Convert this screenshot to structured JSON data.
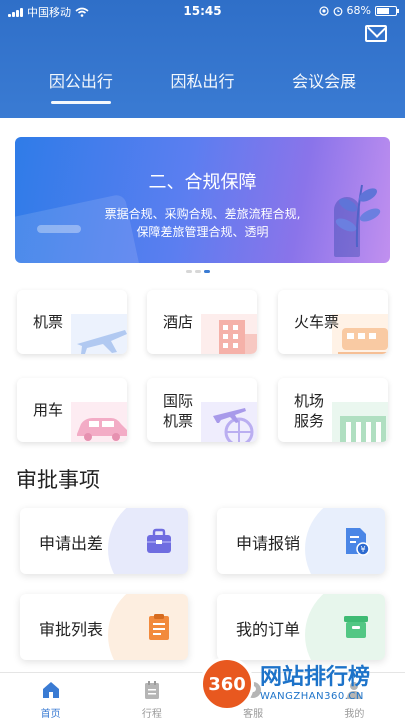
{
  "status_bar": {
    "carrier": "中国移动",
    "time": "15:45",
    "battery": "68%",
    "battery_level": 0.68
  },
  "header": {
    "tabs": [
      {
        "label": "因公出行",
        "active": true
      },
      {
        "label": "因私出行",
        "active": false
      },
      {
        "label": "会议会展",
        "active": false
      }
    ],
    "mail_icon": "mail-icon"
  },
  "banner": {
    "title": "二、合规保障",
    "line1": "票据合规、采购合规、差旅流程合规,",
    "line2": "保障差旅管理合规、透明",
    "page_count": 3,
    "current_page": 3
  },
  "services": [
    {
      "label": "机票",
      "icon": "airplane-icon"
    },
    {
      "label": "酒店",
      "icon": "hotel-icon"
    },
    {
      "label": "火车票",
      "icon": "train-icon"
    },
    {
      "label": "用车",
      "icon": "car-icon"
    },
    {
      "label": "国际\n机票",
      "line1": "国际",
      "line2": "机票",
      "icon": "globe-plane-icon"
    },
    {
      "label": "机场\n服务",
      "line1": "机场",
      "line2": "服务",
      "icon": "airport-icon"
    }
  ],
  "approval": {
    "title": "审批事项",
    "items": [
      {
        "label": "申请出差",
        "icon": "briefcase-icon"
      },
      {
        "label": "申请报销",
        "icon": "receipt-icon"
      },
      {
        "label": "审批列表",
        "icon": "clipboard-icon"
      },
      {
        "label": "我的订单",
        "icon": "inbox-icon"
      }
    ]
  },
  "bottom_nav": [
    {
      "label": "首页",
      "icon": "home-icon",
      "active": true
    },
    {
      "label": "行程",
      "icon": "itinerary-icon",
      "active": false
    },
    {
      "label": "客服",
      "icon": "service-icon",
      "active": false
    },
    {
      "label": "我的",
      "icon": "profile-icon",
      "active": false
    }
  ],
  "watermark": {
    "logo": "360",
    "title": "网站排行榜",
    "subtitle": "WANGZHAN360.CN"
  },
  "colors": {
    "header_blue": "#3a7bd3",
    "accent_blue": "#3a7bd3"
  }
}
